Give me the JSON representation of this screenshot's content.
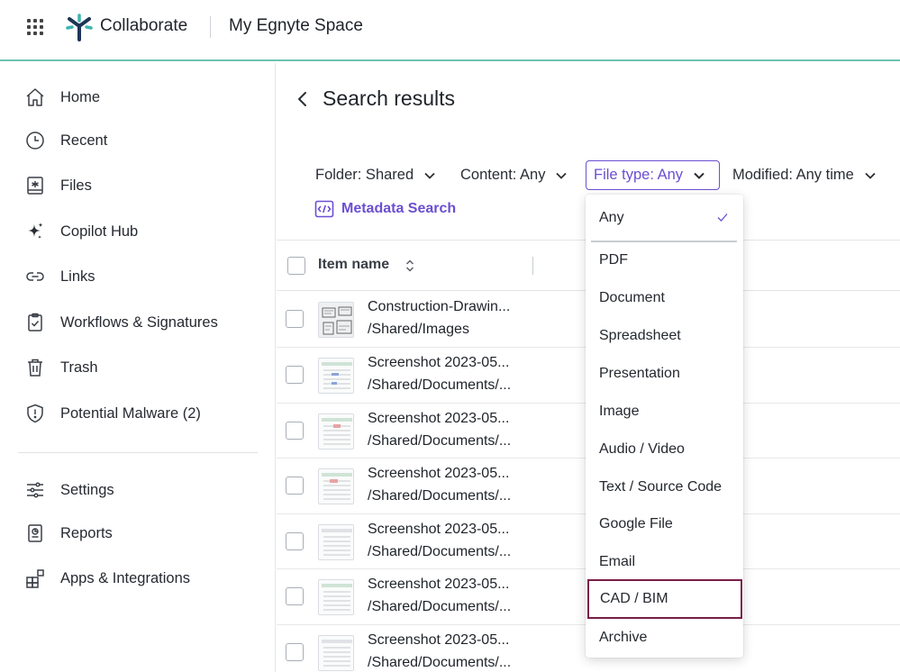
{
  "topbar": {
    "brand": "Collaborate",
    "space_name": "My Egnyte Space"
  },
  "sidebar": {
    "items": [
      {
        "label": "Home",
        "icon": "home-icon"
      },
      {
        "label": "Recent",
        "icon": "clock-icon"
      },
      {
        "label": "Files",
        "icon": "files-icon"
      },
      {
        "label": "Copilot Hub",
        "icon": "sparkle-icon"
      },
      {
        "label": "Links",
        "icon": "link-icon"
      },
      {
        "label": "Workflows & Signatures",
        "icon": "clipboard-check-icon"
      },
      {
        "label": "Trash",
        "icon": "trash-icon"
      },
      {
        "label": "Potential Malware (2)",
        "icon": "shield-alert-icon"
      }
    ],
    "bottom_items": [
      {
        "label": "Settings",
        "icon": "sliders-icon"
      },
      {
        "label": "Reports",
        "icon": "reports-icon"
      },
      {
        "label": "Apps & Integrations",
        "icon": "apps-icon"
      }
    ]
  },
  "main": {
    "title": "Search results",
    "filters": {
      "folder": "Folder: Shared",
      "content": "Content: Any",
      "file_type": "File type: Any",
      "modified": "Modified: Any time"
    },
    "metadata_search": "Metadata Search",
    "table": {
      "column_name": "Item name",
      "rows": [
        {
          "name": "Construction-Drawin...",
          "path": "/Shared/Images"
        },
        {
          "name": "Screenshot 2023-05...",
          "path": "/Shared/Documents/..."
        },
        {
          "name": "Screenshot 2023-05...",
          "path": "/Shared/Documents/..."
        },
        {
          "name": "Screenshot 2023-05...",
          "path": "/Shared/Documents/..."
        },
        {
          "name": "Screenshot 2023-05...",
          "path": "/Shared/Documents/..."
        },
        {
          "name": "Screenshot 2023-05...",
          "path": "/Shared/Documents/..."
        },
        {
          "name": "Screenshot 2023-05...",
          "path": "/Shared/Documents/..."
        }
      ]
    }
  },
  "file_type_dropdown": {
    "selected": "Any",
    "highlighted": "CAD / BIM",
    "options": [
      "Any",
      "PDF",
      "Document",
      "Spreadsheet",
      "Presentation",
      "Image",
      "Audio / Video",
      "Text / Source Code",
      "Google File",
      "Email",
      "CAD / BIM",
      "Archive"
    ]
  },
  "colors": {
    "accent": "#6b4fd1",
    "topbar_border": "#6cc3b3",
    "highlight_border": "#7a1f47",
    "logo_dark": "#1d3557",
    "logo_teal": "#3bb5b0"
  }
}
